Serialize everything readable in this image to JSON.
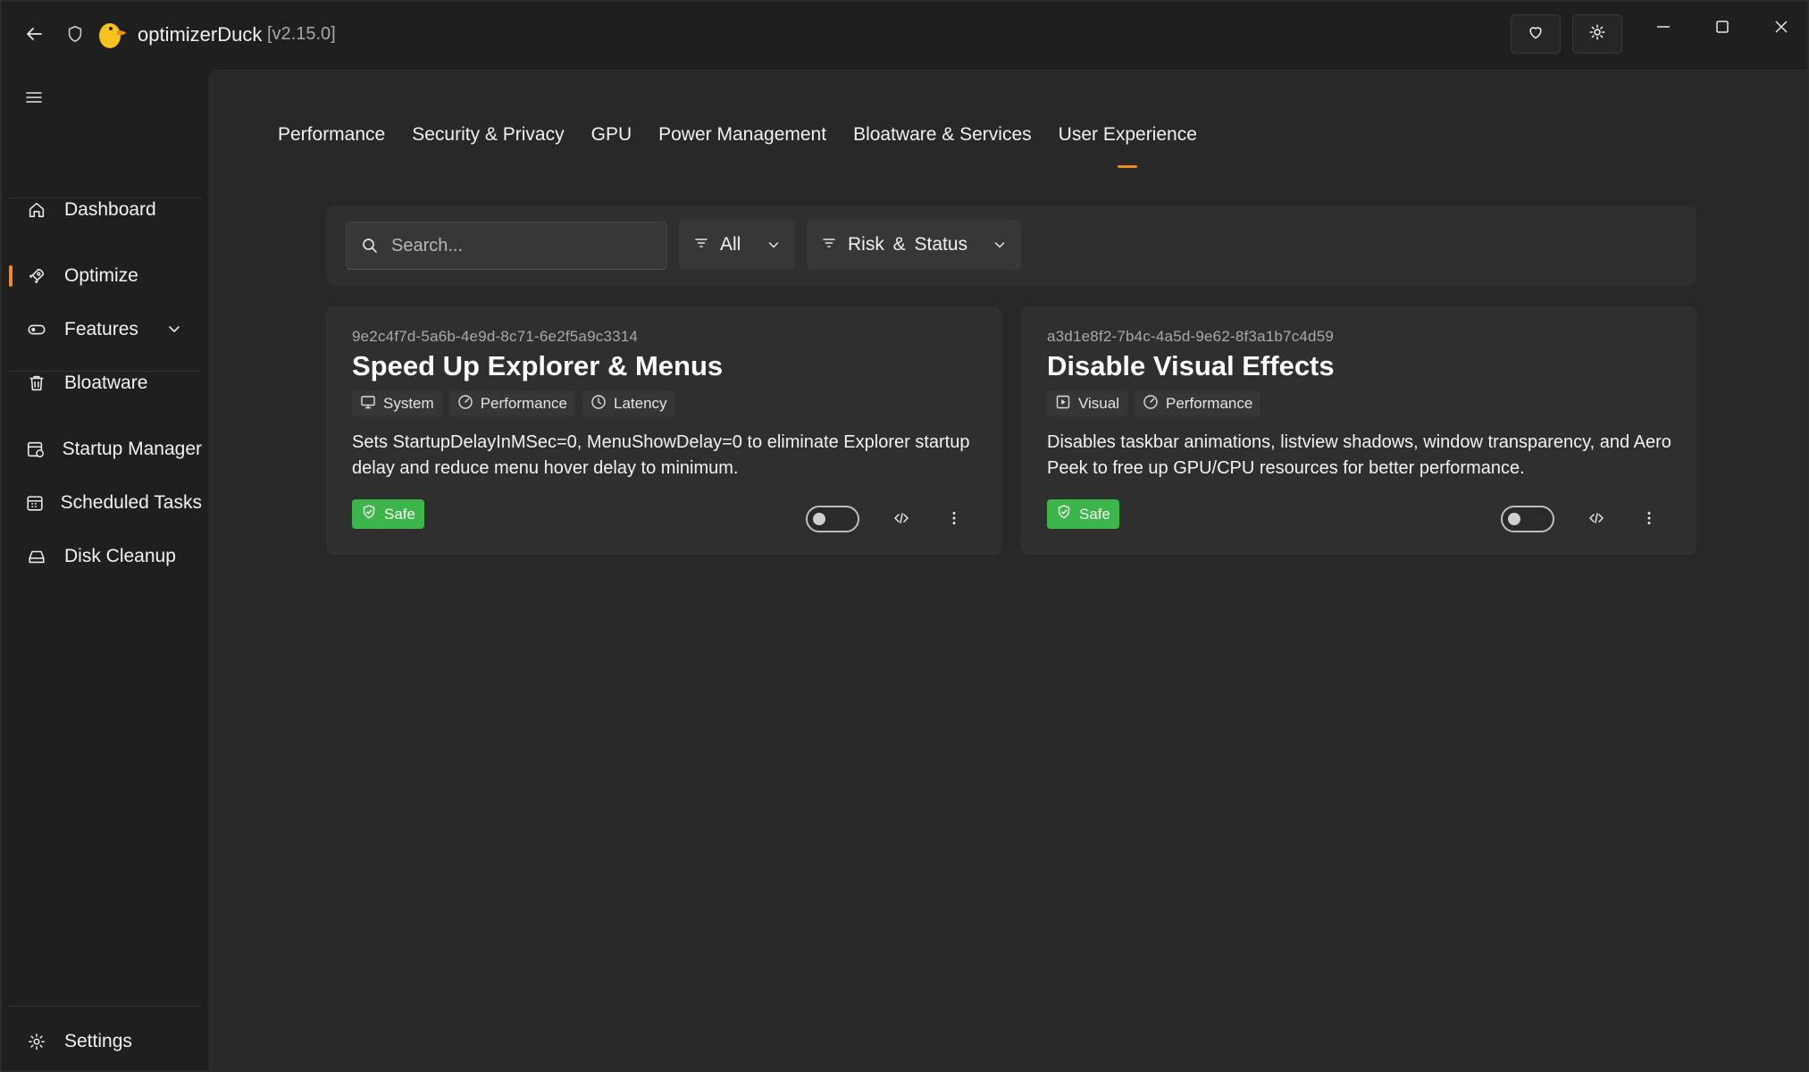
{
  "app": {
    "title": "optimizerDuck",
    "version": "[v2.15.0]",
    "icons": [
      "back-arrow-icon",
      "shield-icon",
      "duck-logo-icon",
      "heart-icon",
      "settings-gear-icon",
      "minimize-icon",
      "maximize-icon",
      "close-icon"
    ]
  },
  "sidebar": {
    "items": [
      {
        "label": "Dashboard",
        "icon": "home-icon"
      },
      {
        "label": "Optimize",
        "icon": "rocket-icon",
        "active": true
      },
      {
        "label": "Features",
        "icon": "toggle-icon",
        "expandable": true
      },
      {
        "label": "Bloatware",
        "icon": "trash-icon"
      },
      {
        "label": "Startup Manager",
        "icon": "startup-icon"
      },
      {
        "label": "Scheduled Tasks",
        "icon": "calendar-icon"
      },
      {
        "label": "Disk Cleanup",
        "icon": "drive-icon"
      }
    ],
    "settings_label": "Settings"
  },
  "tabs": [
    {
      "label": "Performance"
    },
    {
      "label": "Security & Privacy"
    },
    {
      "label": "GPU"
    },
    {
      "label": "Power Management"
    },
    {
      "label": "Bloatware & Services"
    },
    {
      "label": "User Experience",
      "active": true
    }
  ],
  "filters": {
    "search_placeholder": "Search...",
    "category_value": "All",
    "sort_value": "Risk & Status"
  },
  "cards": [
    {
      "id": "9e2c4f7d-5a6b-4e9d-8c71-6e2f5a9c3314",
      "title": "Speed Up Explorer & Menus",
      "tags": [
        {
          "label": "System",
          "icon": "monitor-icon"
        },
        {
          "label": "Performance",
          "icon": "gauge-icon"
        },
        {
          "label": "Latency",
          "icon": "clock-icon"
        }
      ],
      "description": "Sets StartupDelayInMSec=0, MenuShowDelay=0 to eliminate Explorer startup delay and reduce menu hover delay to minimum.",
      "risk": "Safe",
      "enabled": false
    },
    {
      "id": "a3d1e8f2-7b4c-4a5d-9e62-8f3a1b7c4d59",
      "title": "Disable Visual Effects",
      "tags": [
        {
          "label": "Visual",
          "icon": "play-icon"
        },
        {
          "label": "Performance",
          "icon": "gauge-icon"
        }
      ],
      "description": "Disables taskbar animations, listview shadows, window transparency, and Aero Peek to free up GPU/CPU resources for better performance.",
      "risk": "Safe",
      "enabled": false
    }
  ],
  "colors": {
    "accent": "#f08a24",
    "safe": "#3cb54a",
    "background": "#282828",
    "sidebar": "#1f1f1f"
  }
}
